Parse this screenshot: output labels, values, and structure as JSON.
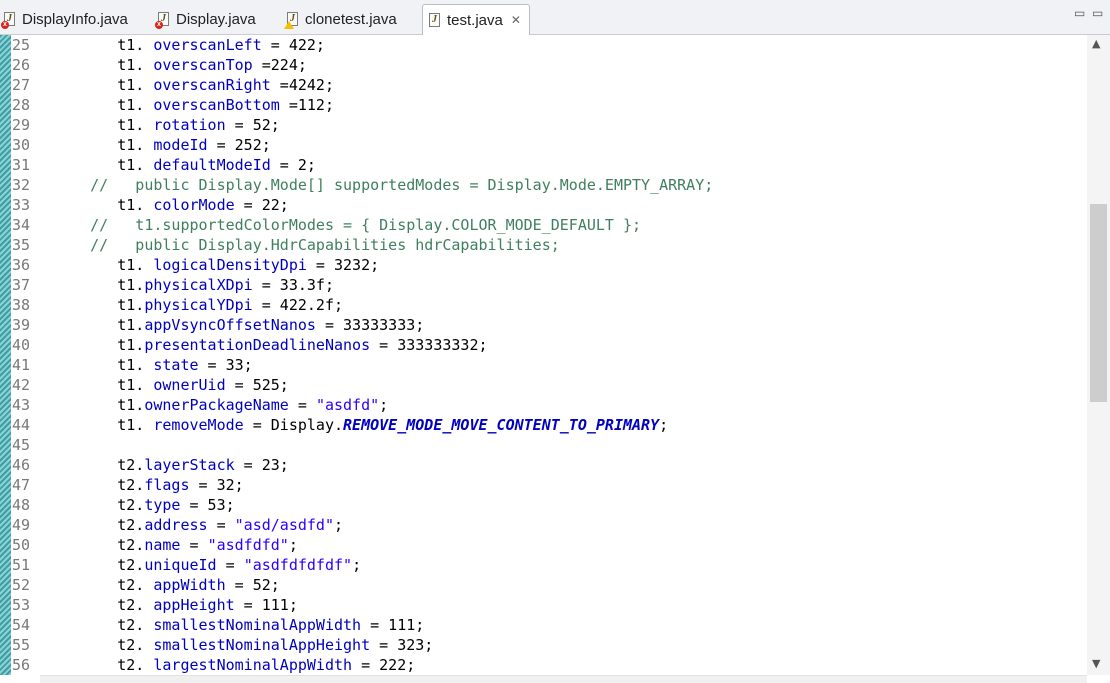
{
  "tabs": [
    {
      "label": "DisplayInfo.java",
      "marker": "error"
    },
    {
      "label": "Display.java",
      "marker": "error"
    },
    {
      "label": "clonetest.java",
      "marker": "warning"
    },
    {
      "label": "test.java",
      "marker": "none",
      "close": "✕"
    }
  ],
  "window_controls": {
    "minimize": "▭",
    "maximize": "▭"
  },
  "editor": {
    "lines": [
      {
        "n": "25",
        "t": [
          [
            "",
            "        t1. "
          ],
          [
            "f",
            "overscanLeft"
          ],
          [
            "",
            " = 422;"
          ]
        ]
      },
      {
        "n": "26",
        "t": [
          [
            "",
            "        t1. "
          ],
          [
            "f",
            "overscanTop"
          ],
          [
            "",
            " =224;"
          ]
        ]
      },
      {
        "n": "27",
        "t": [
          [
            "",
            "        t1. "
          ],
          [
            "f",
            "overscanRight"
          ],
          [
            "",
            " =4242;"
          ]
        ]
      },
      {
        "n": "28",
        "t": [
          [
            "",
            "        t1. "
          ],
          [
            "f",
            "overscanBottom"
          ],
          [
            "",
            " =112;"
          ]
        ]
      },
      {
        "n": "29",
        "t": [
          [
            "",
            "        t1. "
          ],
          [
            "f",
            "rotation"
          ],
          [
            "",
            " = 52;"
          ]
        ]
      },
      {
        "n": "30",
        "t": [
          [
            "",
            "        t1. "
          ],
          [
            "f",
            "modeId"
          ],
          [
            "",
            " = 252;"
          ]
        ]
      },
      {
        "n": "31",
        "t": [
          [
            "",
            "        t1. "
          ],
          [
            "f",
            "defaultModeId"
          ],
          [
            "",
            " = 2;"
          ]
        ]
      },
      {
        "n": "32",
        "t": [
          [
            "c",
            "     //   public Display.Mode[] supportedModes = Display.Mode.EMPTY_ARRAY;"
          ]
        ]
      },
      {
        "n": "33",
        "t": [
          [
            "",
            "        t1. "
          ],
          [
            "f",
            "colorMode"
          ],
          [
            "",
            " = 22;"
          ]
        ]
      },
      {
        "n": "34",
        "t": [
          [
            "c",
            "     //   t1.supportedColorModes = { Display.COLOR_MODE_DEFAULT };"
          ]
        ]
      },
      {
        "n": "35",
        "t": [
          [
            "c",
            "     //   public Display.HdrCapabilities hdrCapabilities;"
          ]
        ]
      },
      {
        "n": "36",
        "t": [
          [
            "",
            "        t1. "
          ],
          [
            "f",
            "logicalDensityDpi"
          ],
          [
            "",
            " = 3232;"
          ]
        ]
      },
      {
        "n": "37",
        "t": [
          [
            "",
            "        t1."
          ],
          [
            "f",
            "physicalXDpi"
          ],
          [
            "",
            " = 33.3f;"
          ]
        ]
      },
      {
        "n": "38",
        "t": [
          [
            "",
            "        t1."
          ],
          [
            "f",
            "physicalYDpi"
          ],
          [
            "",
            " = 422.2f;"
          ]
        ]
      },
      {
        "n": "39",
        "t": [
          [
            "",
            "        t1."
          ],
          [
            "f",
            "appVsyncOffsetNanos"
          ],
          [
            "",
            " = 33333333;"
          ]
        ]
      },
      {
        "n": "40",
        "t": [
          [
            "",
            "        t1."
          ],
          [
            "f",
            "presentationDeadlineNanos"
          ],
          [
            "",
            " = 333333332;"
          ]
        ]
      },
      {
        "n": "41",
        "t": [
          [
            "",
            "        t1. "
          ],
          [
            "f",
            "state"
          ],
          [
            "",
            " = 33;"
          ]
        ]
      },
      {
        "n": "42",
        "t": [
          [
            "",
            "        t1. "
          ],
          [
            "f",
            "ownerUid"
          ],
          [
            "",
            " = 525;"
          ]
        ]
      },
      {
        "n": "43",
        "t": [
          [
            "",
            "        t1."
          ],
          [
            "f",
            "ownerPackageName"
          ],
          [
            "",
            " = "
          ],
          [
            "s",
            "\"asdfd\""
          ],
          [
            "",
            ";"
          ]
        ]
      },
      {
        "n": "44",
        "t": [
          [
            "",
            "        t1. "
          ],
          [
            "f",
            "removeMode"
          ],
          [
            "",
            " = Display."
          ],
          [
            "k",
            "REMOVE_MODE_MOVE_CONTENT_TO_PRIMARY"
          ],
          [
            "",
            ";"
          ]
        ]
      },
      {
        "n": "45",
        "t": [
          [
            "",
            ""
          ]
        ]
      },
      {
        "n": "46",
        "t": [
          [
            "",
            "        t2."
          ],
          [
            "f",
            "layerStack"
          ],
          [
            "",
            " = 23;"
          ]
        ]
      },
      {
        "n": "47",
        "t": [
          [
            "",
            "        t2."
          ],
          [
            "f",
            "flags"
          ],
          [
            "",
            " = 32;"
          ]
        ]
      },
      {
        "n": "48",
        "t": [
          [
            "",
            "        t2."
          ],
          [
            "f",
            "type"
          ],
          [
            "",
            " = 53;"
          ]
        ]
      },
      {
        "n": "49",
        "t": [
          [
            "",
            "        t2."
          ],
          [
            "f",
            "address"
          ],
          [
            "",
            " = "
          ],
          [
            "s",
            "\"asd/asdfd\""
          ],
          [
            "",
            ";"
          ]
        ]
      },
      {
        "n": "50",
        "t": [
          [
            "",
            "        t2."
          ],
          [
            "f",
            "name"
          ],
          [
            "",
            " = "
          ],
          [
            "s",
            "\"asdfdfd\""
          ],
          [
            "",
            ";"
          ]
        ]
      },
      {
        "n": "51",
        "t": [
          [
            "",
            "        t2."
          ],
          [
            "f",
            "uniqueId"
          ],
          [
            "",
            " = "
          ],
          [
            "s",
            "\"asdfdfdfdf\""
          ],
          [
            "",
            ";"
          ]
        ]
      },
      {
        "n": "52",
        "t": [
          [
            "",
            "        t2. "
          ],
          [
            "f",
            "appWidth"
          ],
          [
            "",
            " = 52;"
          ]
        ]
      },
      {
        "n": "53",
        "t": [
          [
            "",
            "        t2. "
          ],
          [
            "f",
            "appHeight"
          ],
          [
            "",
            " = 111;"
          ]
        ]
      },
      {
        "n": "54",
        "t": [
          [
            "",
            "        t2. "
          ],
          [
            "f",
            "smallestNominalAppWidth"
          ],
          [
            "",
            " = 111;"
          ]
        ]
      },
      {
        "n": "55",
        "t": [
          [
            "",
            "        t2. "
          ],
          [
            "f",
            "smallestNominalAppHeight"
          ],
          [
            "",
            " = 323;"
          ]
        ]
      },
      {
        "n": "56",
        "t": [
          [
            "",
            "        t2. "
          ],
          [
            "f",
            "largestNominalAppWidth"
          ],
          [
            "",
            " = 222;"
          ]
        ]
      }
    ]
  },
  "scrollbar": {
    "up": "▲",
    "down": "▼",
    "position": 0.26
  }
}
